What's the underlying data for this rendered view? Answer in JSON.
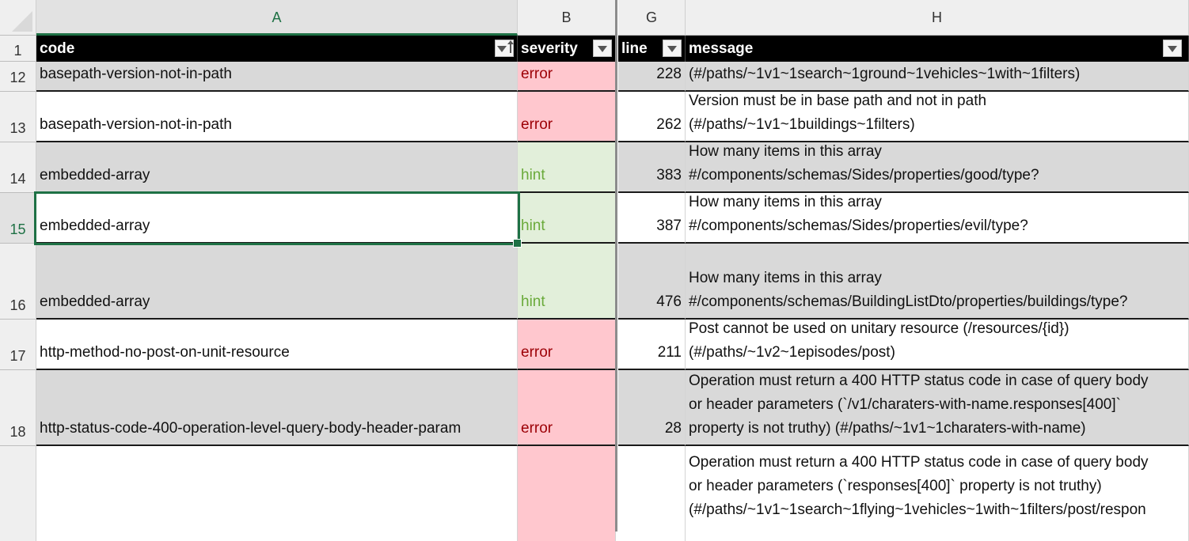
{
  "columns": [
    "A",
    "B",
    "G",
    "H"
  ],
  "header_row_number": "1",
  "headers": {
    "code": "code",
    "severity": "severity",
    "line": "line",
    "message": "message"
  },
  "rows": [
    {
      "num": "12",
      "code": "basepath-version-not-in-path",
      "severity": "error",
      "line": "228",
      "message": "(#/paths/~1v1~1search~1ground~1vehicles~1with~1filters)"
    },
    {
      "num": "13",
      "code": "basepath-version-not-in-path",
      "severity": "error",
      "line": "262",
      "message": "Version must be in base path and not in path\n(#/paths/~1v1~1buildings~1filters)"
    },
    {
      "num": "14",
      "code": "embedded-array",
      "severity": "hint",
      "line": "383",
      "message": "How many items in this array\n#/components/schemas/Sides/properties/good/type?"
    },
    {
      "num": "15",
      "code": "embedded-array",
      "severity": "hint",
      "line": "387",
      "message": "How many items in this array\n#/components/schemas/Sides/properties/evil/type?"
    },
    {
      "num": "16",
      "code": "embedded-array",
      "severity": "hint",
      "line": "476",
      "message": "How many items in this array\n#/components/schemas/BuildingListDto/properties/buildings/type?"
    },
    {
      "num": "17",
      "code": "http-method-no-post-on-unit-resource",
      "severity": "error",
      "line": "211",
      "message": "Post cannot be used on unitary resource (/resources/{id})\n(#/paths/~1v2~1episodes/post)"
    },
    {
      "num": "18",
      "code": "http-status-code-400-operation-level-query-body-header-param",
      "severity": "error",
      "line": "28",
      "message": "Operation must return a 400 HTTP status code in case of query body\nor header parameters (`/v1/charaters-with-name.responses[400]`\nproperty is not truthy) (#/paths/~1v1~1charaters-with-name)"
    },
    {
      "num": "",
      "code": "",
      "severity": "",
      "line": "",
      "message": "Operation must return a 400 HTTP status code in case of query body\nor header parameters (`responses[400]` property is not truthy)\n(#/paths/~1v1~1search~1flying~1vehicles~1with~1filters/post/respon"
    }
  ],
  "colors": {
    "header_bg": "#000000",
    "band_grey": "#d9d9d9",
    "error_fill": "#ffc7ce",
    "error_text": "#9c0006",
    "hint_fill": "#e2efda",
    "hint_text": "#6aaa3a",
    "selection": "#1e7145"
  },
  "selected_cell": "A15"
}
